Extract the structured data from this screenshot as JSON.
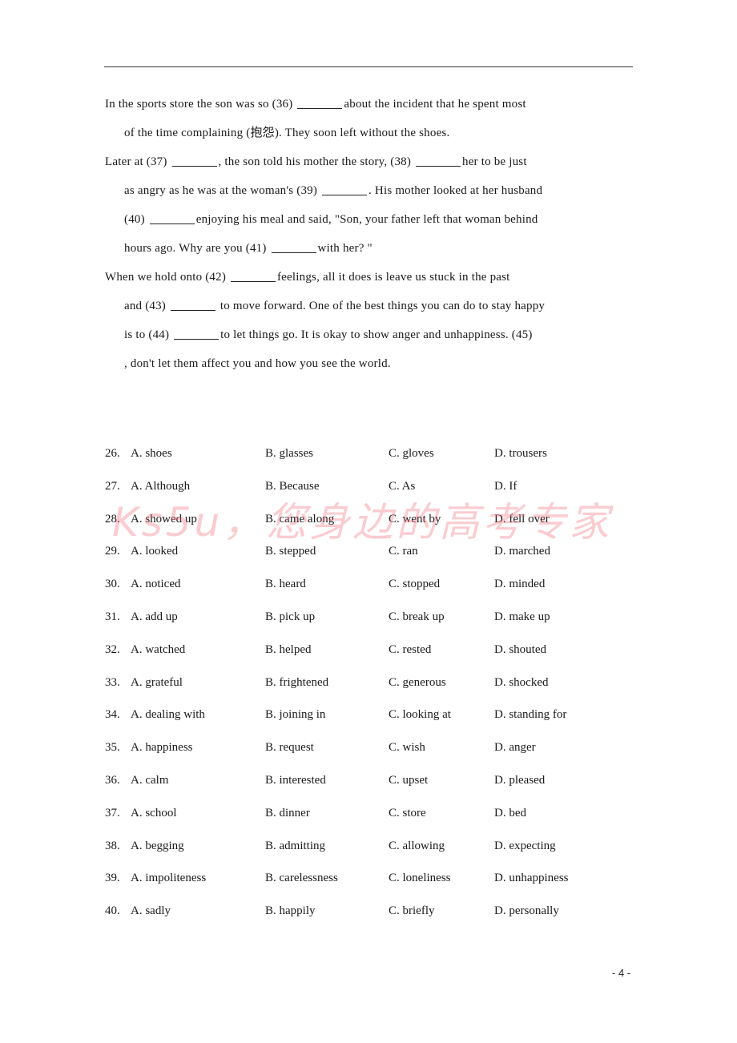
{
  "passage": {
    "lines": [
      {
        "indent": false,
        "parts": [
          "In the sports store the son was so (36) ",
          "__",
          "about the incident that he spent most"
        ]
      },
      {
        "indent": true,
        "parts": [
          "of the time complaining (抱怨). They soon left without the shoes."
        ]
      },
      {
        "indent": false,
        "parts": [
          "Later at (37) ",
          "__",
          ", the son told his mother the story, (38) ",
          "__",
          "her to be just"
        ]
      },
      {
        "indent": true,
        "parts": [
          "as angry as he was at the woman's (39) ",
          "__",
          ". His mother looked at her husband"
        ]
      },
      {
        "indent": true,
        "parts": [
          "(40) ",
          "__",
          "enjoying his meal and said, \"Son, your father left that woman behind"
        ]
      },
      {
        "indent": true,
        "parts": [
          "hours ago. Why are you (41) ",
          "__",
          "with her? \""
        ]
      },
      {
        "indent": false,
        "parts": [
          "When we hold onto (42) ",
          "__",
          "feelings, all it does is leave us stuck in the past"
        ]
      },
      {
        "indent": true,
        "parts": [
          "and (43) ",
          "__",
          " to move forward. One of the best things you can do to stay happy"
        ]
      },
      {
        "indent": true,
        "parts": [
          "is to (44) ",
          "__",
          "to let things go. It is okay to show anger and unhappiness. (45)"
        ]
      },
      {
        "indent": true,
        "parts": [
          ", don't let them affect you and how you see the world."
        ]
      }
    ]
  },
  "options": [
    {
      "num": "26.",
      "a": "A. shoes",
      "b": "B. glasses",
      "c": "C. gloves",
      "d": "D. trousers"
    },
    {
      "num": "27.",
      "a": "A. Although",
      "b": "B. Because",
      "c": "C. As",
      "d": "D. If"
    },
    {
      "num": "28.",
      "a": "A. showed up",
      "b": "B. came along",
      "c": "C. went by",
      "d": "D. fell over"
    },
    {
      "num": "29.",
      "a": "A. looked",
      "b": "B. stepped",
      "c": "C. ran",
      "d": "D. marched"
    },
    {
      "num": "30.",
      "a": "A. noticed",
      "b": "B. heard",
      "c": "C. stopped",
      "d": "D. minded"
    },
    {
      "num": "31.",
      "a": "A. add up",
      "b": "B. pick up",
      "c": "C. break up",
      "d": "D. make up"
    },
    {
      "num": "32.",
      "a": "A. watched",
      "b": "B. helped",
      "c": "C. rested",
      "d": "D. shouted"
    },
    {
      "num": "33.",
      "a": "A. grateful",
      "b": "B. frightened",
      "c": "C. generous",
      "d": "D. shocked"
    },
    {
      "num": "34.",
      "a": "A. dealing with",
      "b": "B. joining in",
      "c": "C. looking at",
      "d": "D. standing for"
    },
    {
      "num": "35.",
      "a": "A. happiness",
      "b": "B. request",
      "c": "C. wish",
      "d": "D. anger"
    },
    {
      "num": "36.",
      "a": "A. calm",
      "b": "B. interested",
      "c": "C. upset",
      "d": "D. pleased"
    },
    {
      "num": "37.",
      "a": "A. school",
      "b": "B. dinner",
      "c": "C. store",
      "d": "D. bed"
    },
    {
      "num": "38.",
      "a": "A. begging",
      "b": "B. admitting",
      "c": "C. allowing",
      "d": "D. expecting"
    },
    {
      "num": "39.",
      "a": "A. impoliteness",
      "b": "B. carelessness",
      "c": "C. loneliness",
      "d": "D. unhappiness"
    },
    {
      "num": "40.",
      "a": "A. sadly",
      "b": "B. happily",
      "c": "C. briefly",
      "d": "D. personally"
    }
  ],
  "watermark": "Ks5u，您身边的高考专家",
  "watermark_color": "#f06e78",
  "page_number": "- 4 -"
}
